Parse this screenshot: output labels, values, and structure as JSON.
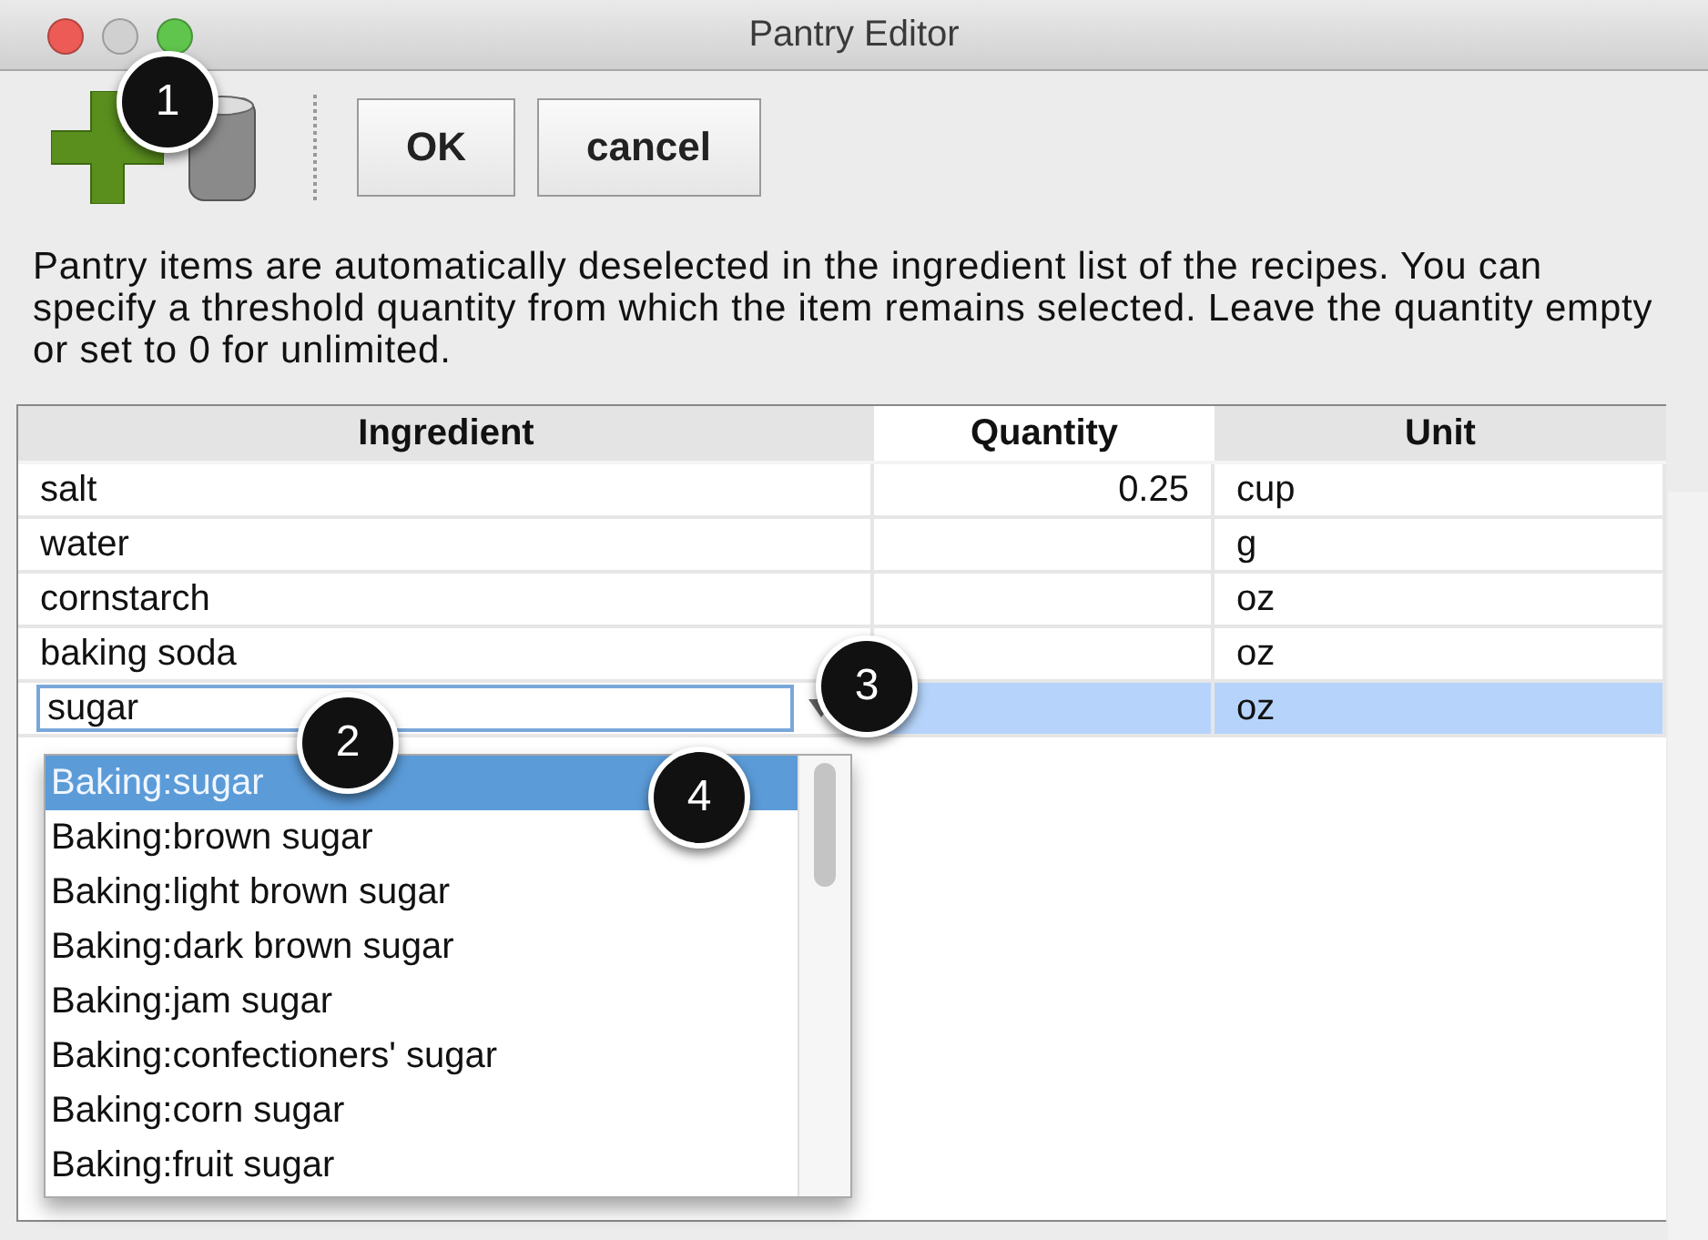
{
  "window": {
    "title": "Pantry Editor"
  },
  "toolbar": {
    "buttons": [
      "OK",
      "cancel"
    ]
  },
  "description": "Pantry items are automatically deselected in the ingredient list of the recipes. You can specify a threshold quantity from which the item remains selected. Leave the quantity empty or set to 0 for unlimited.",
  "table": {
    "columns": [
      "Ingredient",
      "Quantity",
      "Unit"
    ],
    "rows": [
      {
        "ingredient": "salt",
        "quantity": "0.25",
        "unit": "cup",
        "selected": false
      },
      {
        "ingredient": "water",
        "unit": "g",
        "selected": false
      },
      {
        "ingredient": "cornstarch",
        "unit": "oz",
        "selected": false
      },
      {
        "ingredient": "baking soda",
        "unit": "oz",
        "selected": false
      },
      {
        "ingredient": "sugar",
        "unit": "oz",
        "selected": true
      }
    ]
  },
  "suggestions": [
    {
      "label": "Baking:sugar",
      "selected": true
    },
    {
      "label": "Baking:brown sugar",
      "selected": false
    },
    {
      "label": "Baking:light brown sugar",
      "selected": false
    },
    {
      "label": "Baking:dark brown sugar",
      "selected": false
    },
    {
      "label": "Baking:jam sugar",
      "selected": false
    },
    {
      "label": "Baking:confectioners' sugar",
      "selected": false
    },
    {
      "label": "Baking:corn sugar",
      "selected": false
    },
    {
      "label": "Baking:fruit sugar",
      "selected": false
    }
  ],
  "callouts": [
    "1",
    "2",
    "3",
    "4"
  ]
}
